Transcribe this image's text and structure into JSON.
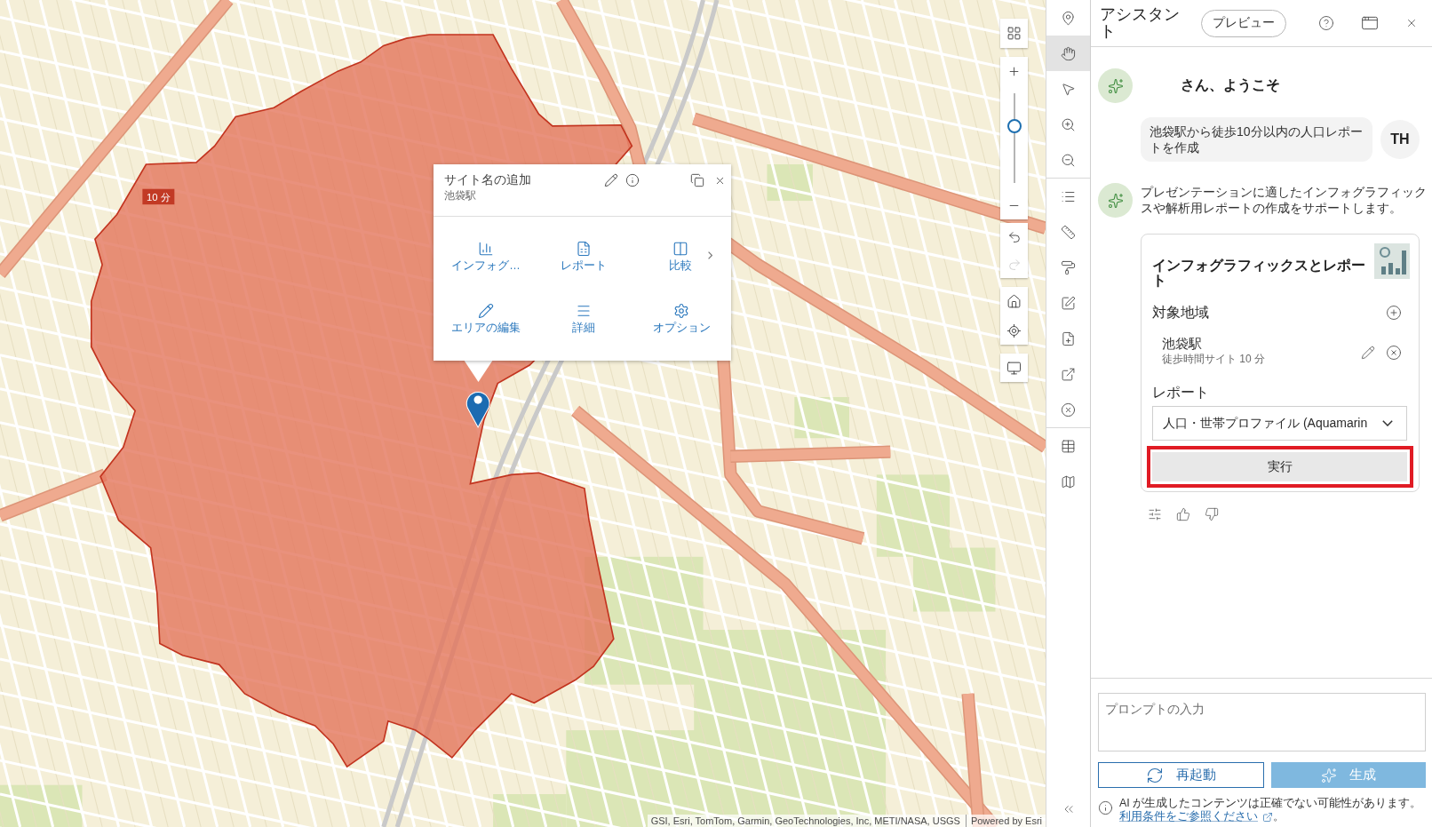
{
  "map": {
    "area_label": "10 分",
    "attribution": "GSI, Esri, TomTom, Garmin, GeoTechnologies, Inc, METI/NASA, USGS",
    "powered_by": "Powered by Esri",
    "popup": {
      "title": "サイト名の追加",
      "subtitle": "池袋駅",
      "next_page": true,
      "actions": [
        {
          "kind": "infographic",
          "label": "インフォグ…"
        },
        {
          "kind": "report",
          "label": "レポート"
        },
        {
          "kind": "compare",
          "label": "比較"
        },
        {
          "kind": "edit_area",
          "label": "エリアの編集"
        },
        {
          "kind": "details",
          "label": "詳細"
        },
        {
          "kind": "options",
          "label": "オプション"
        }
      ]
    },
    "controls": {
      "zoom": {
        "level": 0.63
      },
      "undo_disabled": false,
      "redo_disabled": true
    }
  },
  "toolbar": {
    "groups": [
      {
        "tools": [
          {
            "kind": "pin",
            "selected": false
          },
          {
            "kind": "pan",
            "selected": true
          },
          {
            "kind": "select",
            "selected": false
          },
          {
            "kind": "zoom_in",
            "selected": false
          },
          {
            "kind": "zoom_out",
            "selected": false
          }
        ]
      },
      {
        "tools": [
          {
            "kind": "legend",
            "selected": false
          },
          {
            "kind": "measure",
            "selected": false
          },
          {
            "kind": "style",
            "selected": false
          },
          {
            "kind": "sketch",
            "selected": false
          },
          {
            "kind": "add_file",
            "selected": false
          },
          {
            "kind": "export",
            "selected": false
          },
          {
            "kind": "clear",
            "selected": false
          }
        ]
      },
      {
        "tools": [
          {
            "kind": "table",
            "selected": false
          },
          {
            "kind": "map_tools",
            "selected": false
          }
        ]
      }
    ]
  },
  "assistant": {
    "title": "アシスタント",
    "preview_label": "プレビュー",
    "welcome": "さん、ようこそ",
    "messages": [
      {
        "kind": "user",
        "text": "池袋駅から徒歩10分以内の人口レポートを作成",
        "initials": "TH"
      },
      {
        "kind": "assistant",
        "text": "プレゼンテーションに適したインフォグラフィックスや解析用レポートの作成をサポートします。"
      }
    ],
    "card": {
      "title": "インフォグラフィックスとレポート",
      "area_label": "対象地域",
      "areas": [
        {
          "name": "池袋駅",
          "detail": "徒歩時間サイト 10 分"
        }
      ],
      "report_label": "レポート",
      "report_value": "人口・世帯プロファイル (Aquamarin",
      "run_button": {
        "label": "実行",
        "highlighted": true
      }
    },
    "prompt": {
      "placeholder": "プロンプトの入力"
    },
    "restart_label": "再起動",
    "generate": {
      "label": "生成",
      "disabled": true
    },
    "disclaimer": {
      "text": "AI が生成したコンテンツは正確でない可能性があります。",
      "link": "利用条件をご参照ください",
      "end": "。"
    }
  }
}
